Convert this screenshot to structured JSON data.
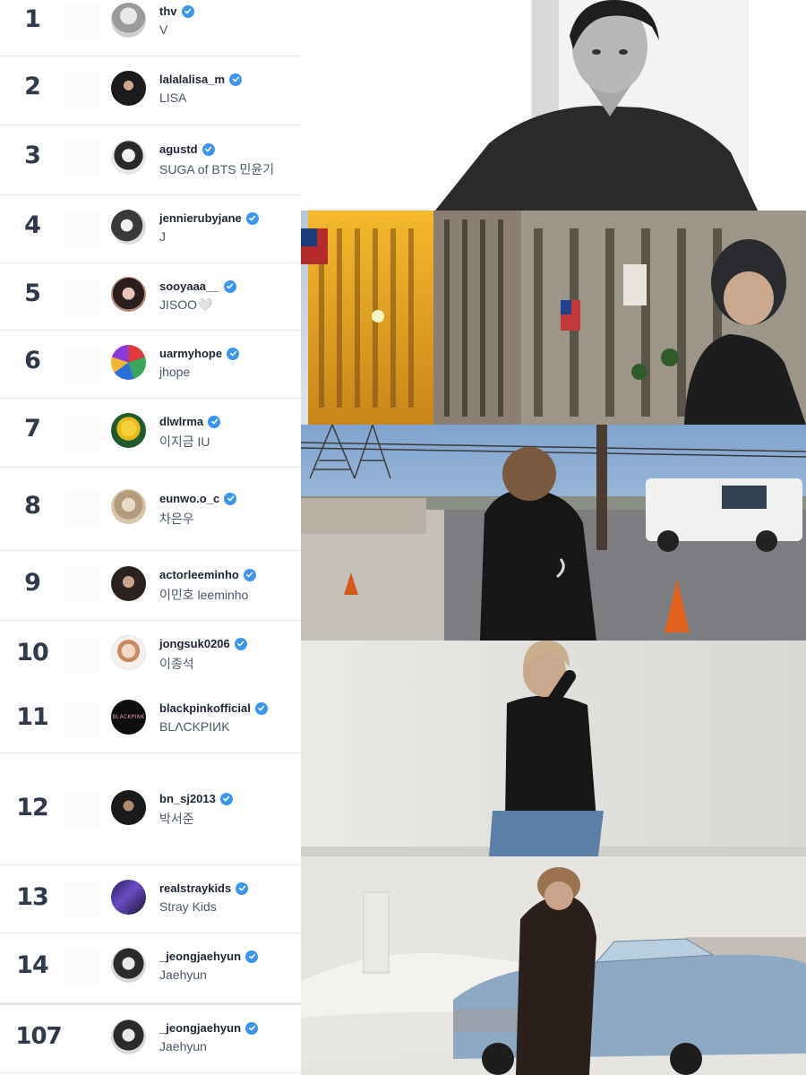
{
  "rankings": [
    {
      "rank": "1",
      "handle": "thv",
      "name": "V",
      "avatar": "avatar-grey"
    },
    {
      "rank": "2",
      "handle": "lalalalisa_m",
      "name": "LISA",
      "avatar": "avatar-dark"
    },
    {
      "rank": "3",
      "handle": "agustd",
      "name": "SUGA of BTS 민윤기",
      "avatar": "avatar-bw"
    },
    {
      "rank": "4",
      "handle": "jennierubyjane",
      "name": "J",
      "avatar": "avatar-bw"
    },
    {
      "rank": "5",
      "handle": "sooyaaa__",
      "name": "JISOO🤍",
      "avatar": "avatar-skin"
    },
    {
      "rank": "6",
      "handle": "uarmyhope",
      "name": "jhope",
      "avatar": "avatar-colorful"
    },
    {
      "rank": "7",
      "handle": "dlwlrma",
      "name": "이지금 IU",
      "avatar": "avatar-tweety"
    },
    {
      "rank": "8",
      "handle": "eunwo.o_c",
      "name": "차은우",
      "avatar": "avatar-beige"
    },
    {
      "rank": "9",
      "handle": "actorleeminho",
      "name": "이민호 leeminho",
      "avatar": "avatar-dark"
    },
    {
      "rank": "10",
      "handle": "jongsuk0206",
      "name": "이종석",
      "avatar": "avatar-light"
    },
    {
      "rank": "11",
      "handle": "blackpinkofficial",
      "name": "BLΛCKPIИK",
      "avatar": "avatar-blackpink"
    },
    {
      "rank": "12",
      "handle": "bn_sj2013",
      "name": "박서준",
      "avatar": "avatar-dark"
    },
    {
      "rank": "13",
      "handle": "realstraykids",
      "name": "Stray Kids",
      "avatar": "avatar-purple"
    },
    {
      "rank": "14",
      "handle": "_jeongjaehyun",
      "name": "Jaehyun",
      "avatar": "avatar-bw"
    },
    {
      "rank": "107",
      "handle": "_jeongjaehyun",
      "name": "Jaehyun",
      "avatar": "avatar-bw"
    }
  ],
  "colors": {
    "rank_text": "#2f3a4a",
    "handle_text": "#1f2733",
    "name_text": "#4d5868",
    "verified_badge": "#3b95f1",
    "divider": "#e6e8eb"
  },
  "icons": {
    "verified": "verified-badge-icon"
  }
}
